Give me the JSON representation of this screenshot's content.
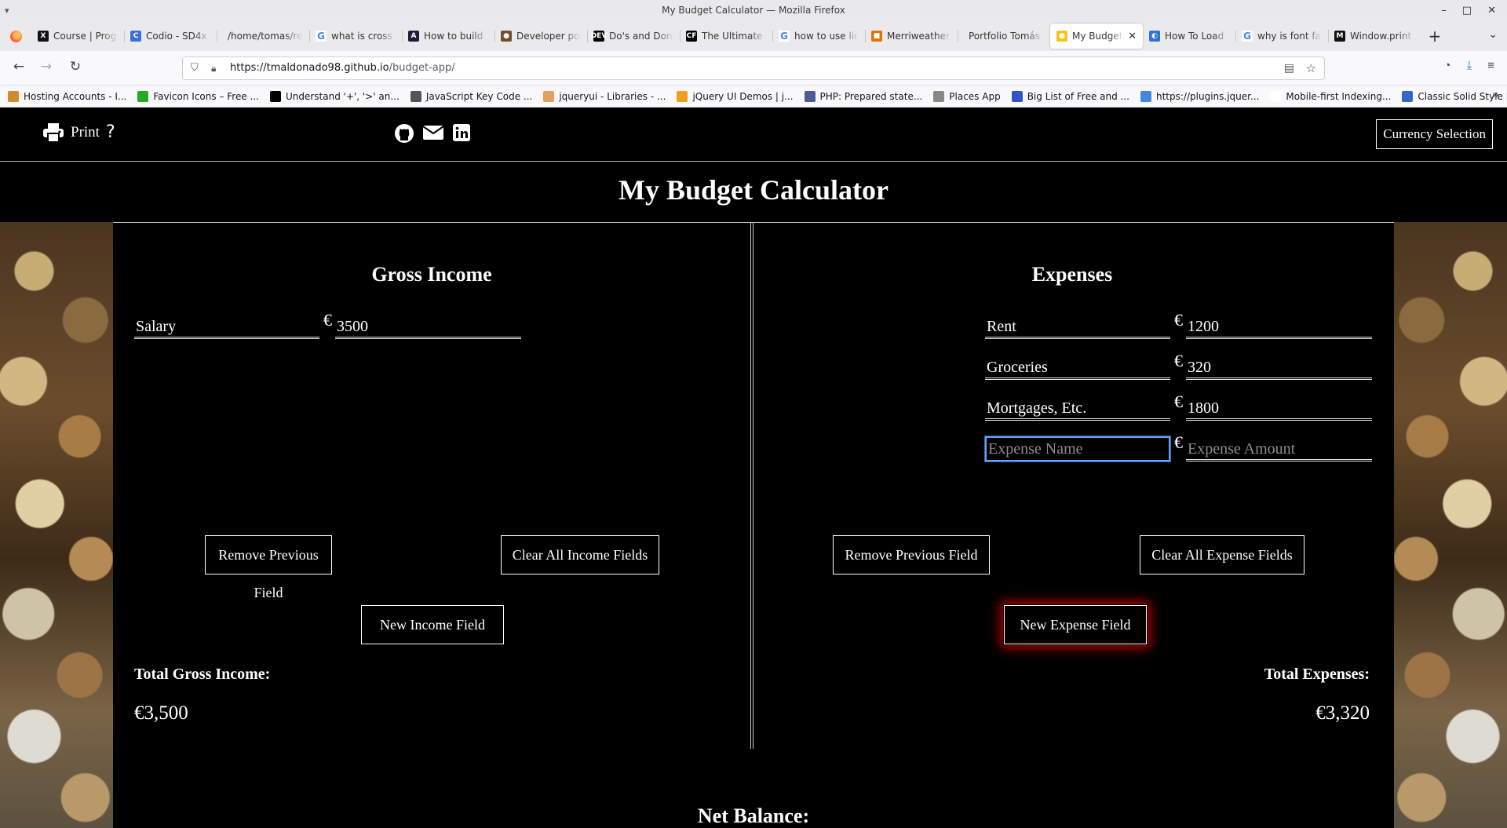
{
  "window": {
    "title": "My Budget Calculator — Mozilla Firefox"
  },
  "tabs": [
    {
      "label": "Course | Prog",
      "fav_color": "#111111",
      "fav_text": "X"
    },
    {
      "label": "Codio - SD4x",
      "fav_color": "#3b6fe0",
      "fav_text": "C"
    },
    {
      "label": "/home/tomas/re",
      "fav_color": "",
      "fav_text": ""
    },
    {
      "label": "what is cross",
      "fav_color": "#ffffff",
      "fav_text": "G"
    },
    {
      "label": "How to build",
      "fav_color": "#1c1c3c",
      "fav_text": "A"
    },
    {
      "label": "Developer po",
      "fav_color": "#7a4b2a",
      "fav_text": "●"
    },
    {
      "label": "Do's and Don",
      "fav_color": "#000000",
      "fav_text": "DEV"
    },
    {
      "label": "The Ultimate",
      "fav_color": "#000000",
      "fav_text": "CF"
    },
    {
      "label": "how to use lir",
      "fav_color": "#ffffff",
      "fav_text": "G"
    },
    {
      "label": "Merriweather",
      "fav_color": "#e37400",
      "fav_text": "■"
    },
    {
      "label": "Portfolio Tomás M",
      "fav_color": "",
      "fav_text": ""
    },
    {
      "label": "My Budget",
      "fav_color": "#f5c518",
      "fav_text": "●",
      "active": true
    },
    {
      "label": "How To Load",
      "fav_color": "#2f74d0",
      "fav_text": "◐"
    },
    {
      "label": "why is font fa",
      "fav_color": "#ffffff",
      "fav_text": "G"
    },
    {
      "label": "Window.print",
      "fav_color": "#111111",
      "fav_text": "M"
    }
  ],
  "navbar": {
    "url_host": "https://tmaldonado98.github.io",
    "url_path": "/budget-app/"
  },
  "bookmarks": [
    {
      "label": "Hosting Accounts - I...",
      "color": "#d08b2c"
    },
    {
      "label": "Favicon Icons – Free ...",
      "color": "#22aa22"
    },
    {
      "label": "Understand '+', '>' an...",
      "color": "#000000"
    },
    {
      "label": "JavaScript Key Code ...",
      "color": "#555555"
    },
    {
      "label": "jqueryui - Libraries - ...",
      "color": "#e0a060"
    },
    {
      "label": "jQuery UI Demos | j...",
      "color": "#f0a020"
    },
    {
      "label": "PHP: Prepared state...",
      "color": "#4f5b93"
    },
    {
      "label": "Places App",
      "color": "#888888"
    },
    {
      "label": "Big List of Free and ...",
      "color": "#3355cc"
    },
    {
      "label": "https://plugins.jquer...",
      "color": "#4488dd"
    },
    {
      "label": "Mobile-first Indexing...",
      "color": "#ffffff"
    },
    {
      "label": "Classic Solid Style Ic...",
      "color": "#3366cc"
    }
  ],
  "page": {
    "print_label": "Print",
    "help_label": "?",
    "currency_button": "Currency Selection",
    "title": "My Budget Calculator",
    "income": {
      "heading": "Gross Income",
      "fields": [
        {
          "name": "Salary",
          "currency": "€",
          "amount": "3500"
        }
      ],
      "remove_button": "Remove Previous Field",
      "clear_button": "Clear All Income Fields",
      "new_button": "New Income Field",
      "total_label": "Total Gross Income:",
      "total_value": "€3,500"
    },
    "expenses": {
      "heading": "Expenses",
      "fields": [
        {
          "name": "Rent",
          "currency": "€",
          "amount": "1200"
        },
        {
          "name": "Groceries",
          "currency": "€",
          "amount": "320"
        },
        {
          "name": "Mortgages, Etc.",
          "currency": "€",
          "amount": "1800"
        }
      ],
      "empty_field": {
        "name_placeholder": "Expense Name",
        "currency": "€",
        "amount_placeholder": "Expense Amount"
      },
      "remove_button": "Remove Previous Field",
      "clear_button": "Clear All Expense Fields",
      "new_button": "New Expense Field",
      "total_label": "Total Expenses:",
      "total_value": "€3,320"
    },
    "net_label": "Net Balance:"
  }
}
